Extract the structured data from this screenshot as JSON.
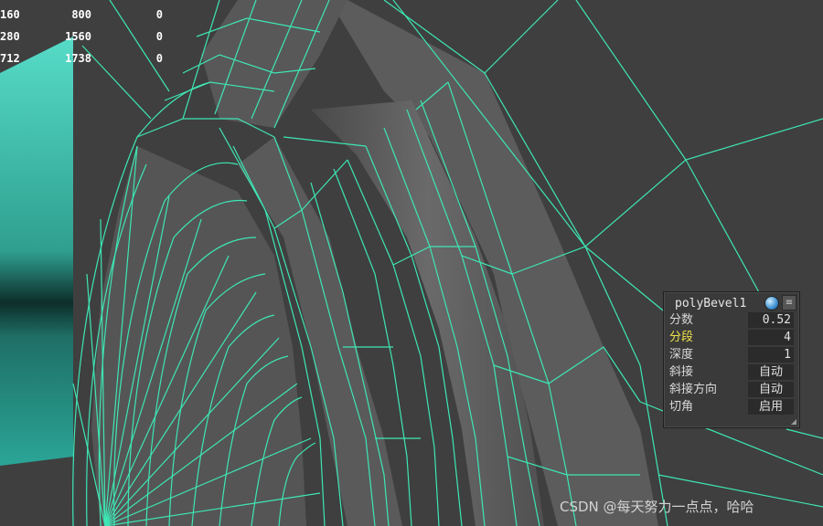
{
  "stats": {
    "rows": [
      [
        "160",
        "800",
        "0"
      ],
      [
        "280",
        "1560",
        "0"
      ],
      [
        "712",
        "1738",
        "0"
      ]
    ]
  },
  "bevel_panel": {
    "title": "polyBevel1",
    "icons": [
      "visibility-icon",
      "menu-icon"
    ],
    "attributes": [
      {
        "label": "分数",
        "value": "0.52"
      },
      {
        "label": "分段",
        "value": "4",
        "highlighted": true
      },
      {
        "label": "深度",
        "value": "1"
      },
      {
        "label": "斜接",
        "value": "自动"
      },
      {
        "label": "斜接方向",
        "value": "自动"
      },
      {
        "label": "切角",
        "value": "启用"
      }
    ]
  },
  "watermark": "CSDN @每天努力一点点，哈哈",
  "colors": {
    "background": "#3f3f3f",
    "wireframe": "#3ee6b4",
    "highlight_text": "#f1e34d",
    "cyan_object": "#4fd3bf"
  }
}
